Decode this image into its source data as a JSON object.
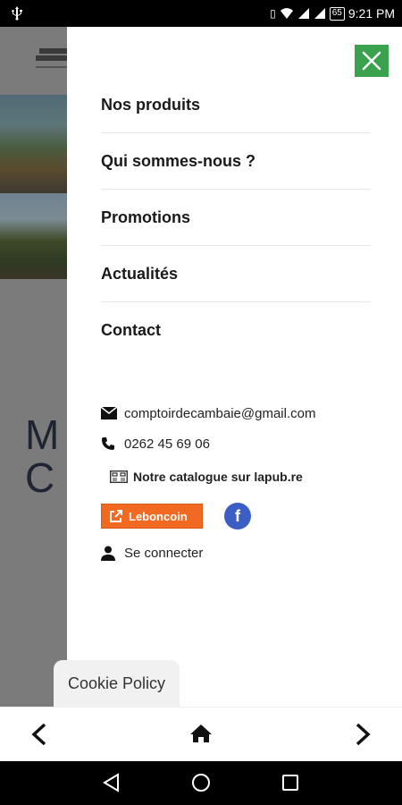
{
  "status_bar": {
    "time": "9:21 PM",
    "battery": "65",
    "icons": [
      "usb-icon",
      "vibrate-icon",
      "wifi-icon",
      "signal-icon",
      "signal-icon",
      "battery-icon"
    ]
  },
  "background_page": {
    "heading_line1": "M",
    "heading_line2": "C"
  },
  "drawer": {
    "menu": [
      {
        "label": "Nos produits"
      },
      {
        "label": "Qui sommes-nous ?"
      },
      {
        "label": "Promotions"
      },
      {
        "label": "Actualités"
      },
      {
        "label": "Contact"
      }
    ],
    "email": "comptoirdecambaie@gmail.com",
    "phone": "0262 45 69 06",
    "catalog": "Notre catalogue sur lapub.re",
    "leboncoin": "Leboncoin",
    "facebook": "f",
    "login": "Se connecter"
  },
  "cookie": {
    "label": "Cookie Policy"
  },
  "colors": {
    "close": "#3aa24f",
    "leboncoin": "#f26a21",
    "facebook": "#3b5ec4"
  }
}
